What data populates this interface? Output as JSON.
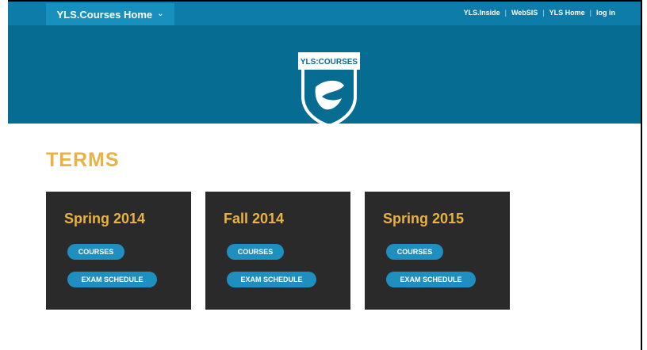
{
  "topbar": {
    "home_menu_label": "YLS.Courses Home",
    "links": [
      "YLS.Inside",
      "WebSIS",
      "YLS Home",
      "log in"
    ],
    "bg_color": "#0d7ca8"
  },
  "banner": {
    "logo_text": "YLS:COURSES",
    "bg_color": "#076c91"
  },
  "main": {
    "section_title": "TERMS",
    "accent_color": "#e8b344",
    "terms": [
      {
        "title": "Spring 2014",
        "courses_label": "COURSES",
        "exam_label": "EXAM SCHEDULE"
      },
      {
        "title": "Fall 2014",
        "courses_label": "COURSES",
        "exam_label": "EXAM SCHEDULE"
      },
      {
        "title": "Spring 2015",
        "courses_label": "COURSES",
        "exam_label": "EXAM SCHEDULE"
      }
    ]
  },
  "icons": {
    "menu_chevron": "chevron-down-icon",
    "logo": "shield-logo-icon"
  }
}
